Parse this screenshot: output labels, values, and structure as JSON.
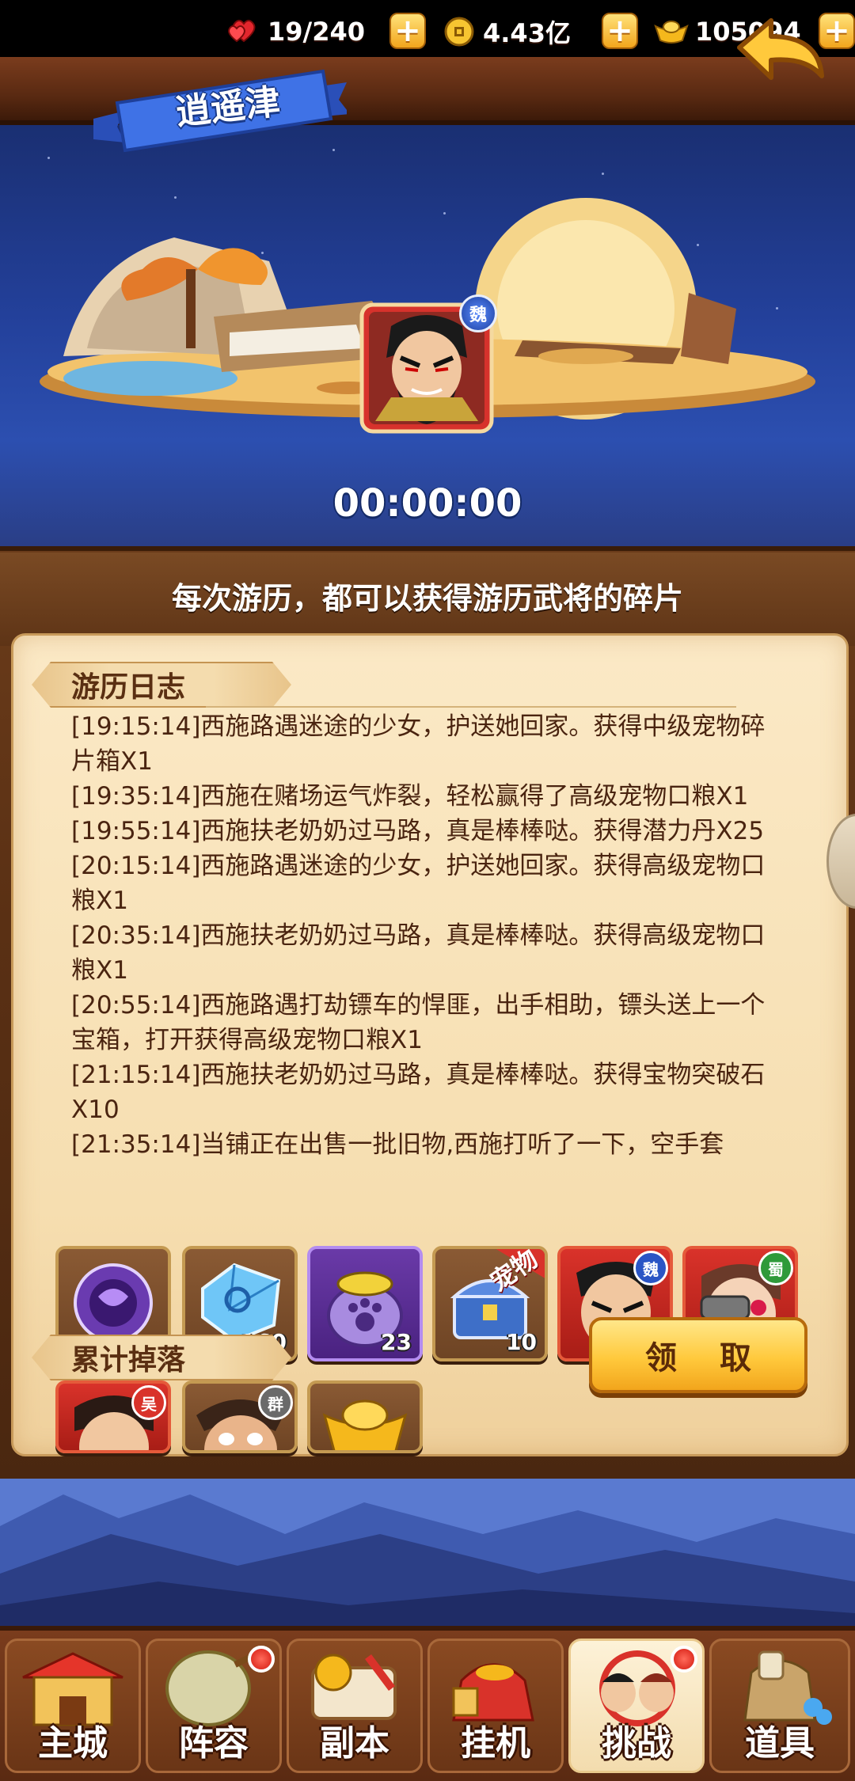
{
  "resources": {
    "stamina": "19/240",
    "coins": "4.43亿",
    "gold": "105094"
  },
  "scene": {
    "location": "逍遥津",
    "hero_faction": "魏",
    "timer": "00:00:00"
  },
  "panel": {
    "subtitle": "每次游历，都可以获得游历武将的碎片",
    "log_title": "游历日志",
    "log_entries": [
      "[19:15:14]西施路遇迷途的少女，护送她回家。获得中级宠物碎片箱X1",
      "[19:35:14]西施在赌场运气炸裂，轻松赢得了高级宠物口粮X1",
      "[19:55:14]西施扶老奶奶过马路，真是棒棒哒。获得潜力丹X25",
      "[20:15:14]西施路遇迷途的少女，护送她回家。获得高级宠物口粮X1",
      "[20:35:14]西施扶老奶奶过马路，真是棒棒哒。获得高级宠物口粮X1",
      "[20:55:14]西施路遇打劫镖车的悍匪，出手相助，镖头送上一个宝箱，打开获得高级宠物口粮X1",
      "[21:15:14]西施扶老奶奶过马路，真是棒棒哒。获得宝物突破石X10",
      "[21:35:14]当铺正在出售一批旧物,西施打听了一下，空手套"
    ],
    "drops_title": "累计掉落",
    "claim_label": "领 取",
    "drops": [
      {
        "name": "purple-orb",
        "count": ""
      },
      {
        "name": "blue-crystal",
        "count": "160"
      },
      {
        "name": "pet-food-bag",
        "count": "23"
      },
      {
        "name": "pet-chest",
        "count": "10",
        "ribbon": "宠物"
      },
      {
        "name": "hero-wei",
        "count": "",
        "faction": "魏"
      },
      {
        "name": "hero-shu",
        "count": "",
        "faction": "蜀"
      }
    ],
    "drops_row2": [
      {
        "name": "hero-wu",
        "count": "",
        "faction": "吴"
      },
      {
        "name": "hero-qun",
        "count": "",
        "faction": "群"
      },
      {
        "name": "gold-ingot",
        "count": ""
      }
    ]
  },
  "nav": {
    "tabs": [
      "主城",
      "阵容",
      "副本",
      "挂机",
      "挑战",
      "道具"
    ],
    "active": "挑战"
  },
  "colors": {
    "wood": "#5a2a12",
    "parchment": "#f6deb0",
    "gold_button": "#ffc93c",
    "text_brown": "#4a2410",
    "notification": "#d41a10"
  }
}
